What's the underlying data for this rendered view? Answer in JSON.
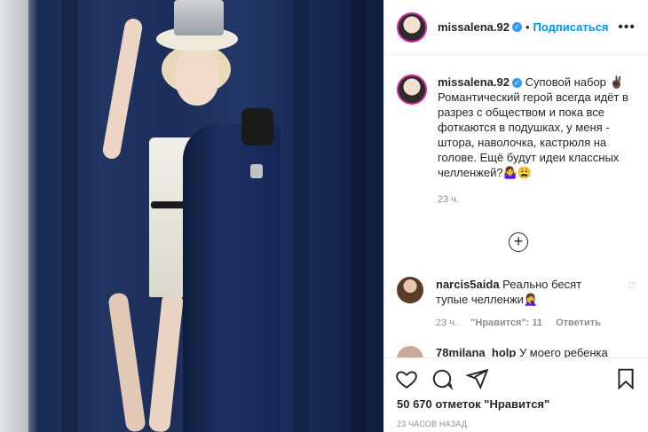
{
  "post": {
    "username": "missalena.92",
    "follow_label": "Подписаться",
    "more_label": "•••"
  },
  "caption": {
    "username": "missalena.92",
    "text": "Суповой набор ✌🏿 Романтический герой всегда идёт в разрез с обществом и пока все фоткаются в подушках, у меня - штора, наволочка, кастрюля на голове. Ещё будут идеи классных челленжей?🤷‍♀️😩",
    "time": "23 ч."
  },
  "load_more": "+",
  "comments": [
    {
      "username": "narcis5aida",
      "text": "Реально бесят тупые челленжи🤦‍♀️",
      "time": "23 ч.",
      "likes": "\"Нравится\": 11",
      "reply": "Ответить"
    },
    {
      "username": "78milana_holp",
      "text": "У моего ребенка"
    }
  ],
  "footer": {
    "likes": "50 670 отметок \"Нравится\"",
    "date": "23 ЧАСОВ НАЗАД"
  },
  "colors": {
    "accent": "#0095f6",
    "verified": "#3897f0",
    "muted": "#8e8e8e"
  },
  "icons": [
    "heart-icon",
    "comment-icon",
    "share-icon",
    "bookmark-icon",
    "verified-icon",
    "plus-circle-icon",
    "more-icon"
  ]
}
